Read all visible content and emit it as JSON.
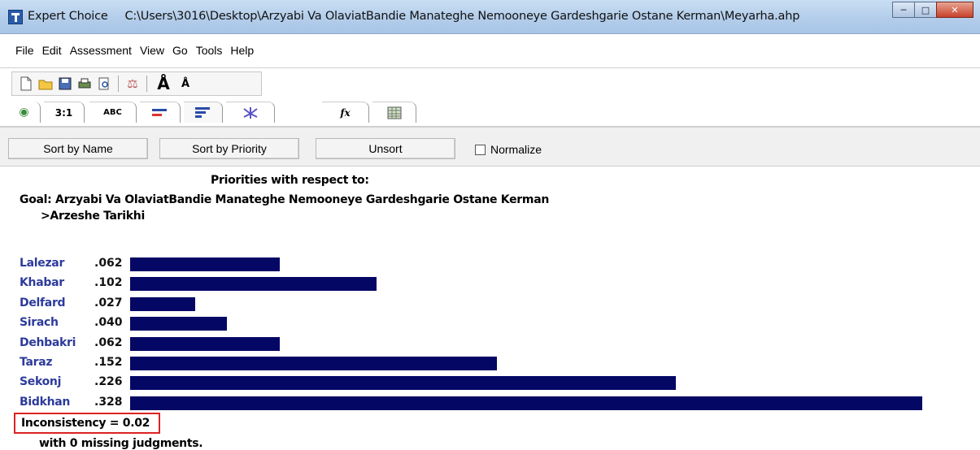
{
  "window": {
    "app_name": "Expert Choice",
    "path": "C:\\Users\\3016\\Desktop\\Arzyabi Va OlaviatBandie Manateghe Nemooneye Gardeshgarie Ostane Kerman\\Meyarha.ahp"
  },
  "menu": [
    "File",
    "Edit",
    "Assessment",
    "View",
    "Go",
    "Tools",
    "Help"
  ],
  "toolbar": {
    "icons": [
      "new-icon",
      "open-icon",
      "save-icon",
      "print-icon",
      "preview-icon",
      "scale-icon",
      "font-larger-icon",
      "font-smaller-icon"
    ]
  },
  "tabs": [
    {
      "icon": "tree-icon",
      "label": ""
    },
    {
      "icon": "pairwise-icon",
      "label": "3:1"
    },
    {
      "icon": "verbal-icon",
      "label": "ABC"
    },
    {
      "icon": "graphic-icon",
      "label": ""
    },
    {
      "icon": "bars-icon",
      "label": ""
    },
    {
      "icon": "sensitivity-icon",
      "label": ""
    },
    {
      "icon": "formula-icon",
      "label": "fx"
    },
    {
      "icon": "grid-icon",
      "label": ""
    }
  ],
  "sortbar": {
    "sort_name": "Sort by Name",
    "sort_priority": "Sort by Priority",
    "unsort": "Unsort",
    "normalize": "Normalize"
  },
  "priorities": {
    "heading": "Priorities with respect to:",
    "goal": "Goal: Arzyabi Va OlaviatBandie Manateghe Nemooneye Gardeshgarie Ostane Kerman",
    "node": ">Arzeshe Tarikhi"
  },
  "chart_data": {
    "type": "bar",
    "categories": [
      "Lalezar",
      "Khabar",
      "Delfard",
      "Sirach",
      "Dehbakri",
      "Taraz",
      "Sekonj",
      "Bidkhan"
    ],
    "values": [
      0.062,
      0.102,
      0.027,
      0.04,
      0.062,
      0.152,
      0.226,
      0.328
    ],
    "value_labels": [
      ".062",
      ".102",
      ".027",
      ".040",
      ".062",
      ".152",
      ".226",
      ".328"
    ],
    "bar_color": "#050765",
    "orientation": "horizontal"
  },
  "footer": {
    "inconsistency": "Inconsistency = 0.02",
    "missing": "with 0  missing judgments."
  },
  "colors": {
    "label_blue": "#2d3b9c",
    "highlight_red": "#dd2222"
  }
}
